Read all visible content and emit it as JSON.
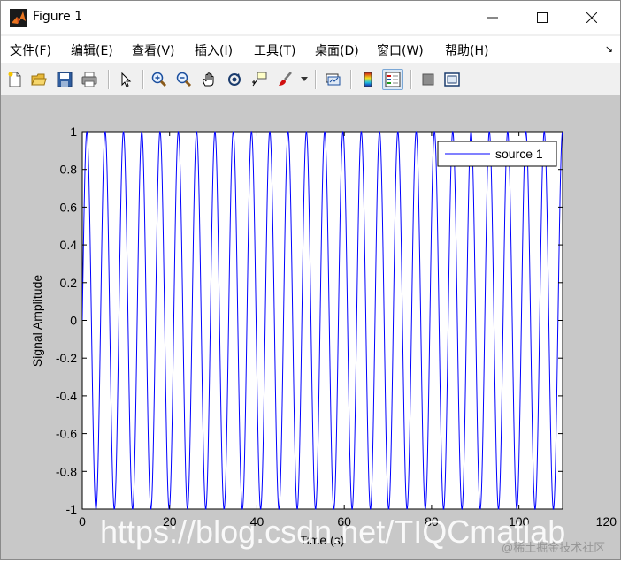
{
  "window": {
    "title": "Figure 1"
  },
  "menu": {
    "items": [
      "文件(F)",
      "编辑(E)",
      "查看(V)",
      "插入(I)",
      "工具(T)",
      "桌面(D)",
      "窗口(W)",
      "帮助(H)"
    ]
  },
  "icons": {
    "toolbar": [
      "new-figure-icon",
      "open-file-icon",
      "save-icon",
      "print-icon",
      "pointer-icon",
      "zoom-in-icon",
      "zoom-out-icon",
      "pan-icon",
      "rotate-3d-icon",
      "data-cursor-icon",
      "brush-icon",
      "link-plot-icon",
      "colorbar-icon",
      "legend-icon",
      "hide-plot-tools-icon",
      "show-plot-tools-icon"
    ],
    "accent": "#7aa7d6"
  },
  "chart_data": {
    "type": "line",
    "title": "",
    "xlabel": "Time (s)",
    "ylabel": "Signal Amplitude",
    "xlim": [
      0,
      110
    ],
    "ylim": [
      -1,
      1
    ],
    "xticks": [
      "0",
      "20",
      "40",
      "60",
      "80",
      "100",
      "120"
    ],
    "yticks": [
      "1",
      "0.8",
      "0.6",
      "0.4",
      "0.2",
      "0",
      "-0.2",
      "-0.4",
      "-0.6",
      "-0.8",
      "-1"
    ],
    "grid": false,
    "legend_position": "top-right",
    "series": [
      {
        "name": "source 1",
        "color": "#0000ff",
        "function": "sin",
        "period": 4.19,
        "x_start": 0,
        "x_end": 125
      }
    ]
  },
  "watermark": {
    "main": "https://blog.csdn.net/TIQCmatlab",
    "secondary": "@稀土掘金技术社区"
  }
}
